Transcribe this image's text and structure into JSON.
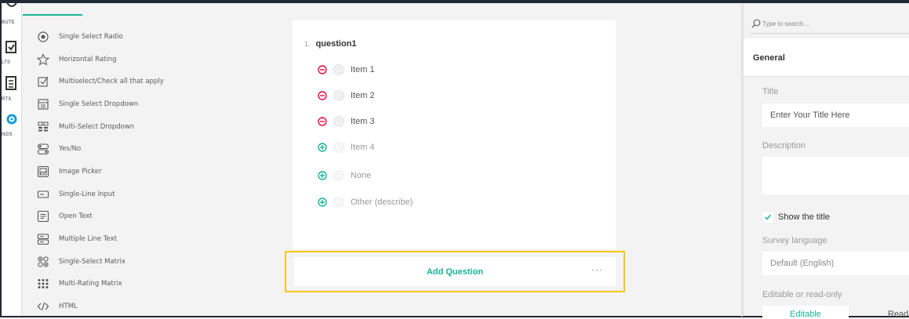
{
  "nav_rail": {
    "items": [
      {
        "label": "BUTE",
        "icon": "distribute-icon"
      },
      {
        "label": "LTS",
        "icon": "results-icon"
      },
      {
        "label": "RTS",
        "icon": "reports-icon"
      },
      {
        "label": "NGS",
        "icon": "settings-icon"
      }
    ]
  },
  "toolbox": {
    "items": [
      {
        "label": "Single Select Radio",
        "icon": "radio-icon"
      },
      {
        "label": "Horizontal Rating",
        "icon": "star-icon"
      },
      {
        "label": "Multiselect/Check all that apply",
        "icon": "checkbox-icon"
      },
      {
        "label": "Single Select Dropdown",
        "icon": "dropdown-icon"
      },
      {
        "label": "Multi-Select Dropdown",
        "icon": "multi-dropdown-icon"
      },
      {
        "label": "Yes/No",
        "icon": "toggle-icon"
      },
      {
        "label": "Image Picker",
        "icon": "image-icon"
      },
      {
        "label": "Single-Line Input",
        "icon": "text-input-icon"
      },
      {
        "label": "Open Text",
        "icon": "comment-icon"
      },
      {
        "label": "Multiple Line Text",
        "icon": "multiline-icon"
      },
      {
        "label": "Single-Select Matrix",
        "icon": "matrix-icon"
      },
      {
        "label": "Multi-Rating Matrix",
        "icon": "rating-matrix-icon"
      },
      {
        "label": "HTML",
        "icon": "code-icon"
      }
    ]
  },
  "question": {
    "number": "1.",
    "name": "question1",
    "choices": [
      {
        "label": "Item 1",
        "action": "remove"
      },
      {
        "label": "Item 2",
        "action": "remove"
      },
      {
        "label": "Item 3",
        "action": "remove"
      },
      {
        "label": "Item 4",
        "action": "add"
      },
      {
        "label": "None",
        "action": "add"
      },
      {
        "label": "Other (describe)",
        "action": "add"
      }
    ]
  },
  "add_question": {
    "label": "Add Question",
    "more": "···"
  },
  "properties": {
    "search_placeholder": "Type to search...",
    "category": "General",
    "title_label": "Title",
    "title_value": "Enter Your Title Here",
    "description_label": "Description",
    "description_value": "",
    "show_title_label": "Show the title",
    "show_title_checked": true,
    "language_label": "Survey language",
    "language_value": "Default (English)",
    "mode_label": "Editable or read-only",
    "mode_options": [
      "Editable",
      "Read"
    ]
  },
  "colors": {
    "accent": "#19b394",
    "remove": "#e50a3e",
    "highlight": "#f5c518"
  }
}
